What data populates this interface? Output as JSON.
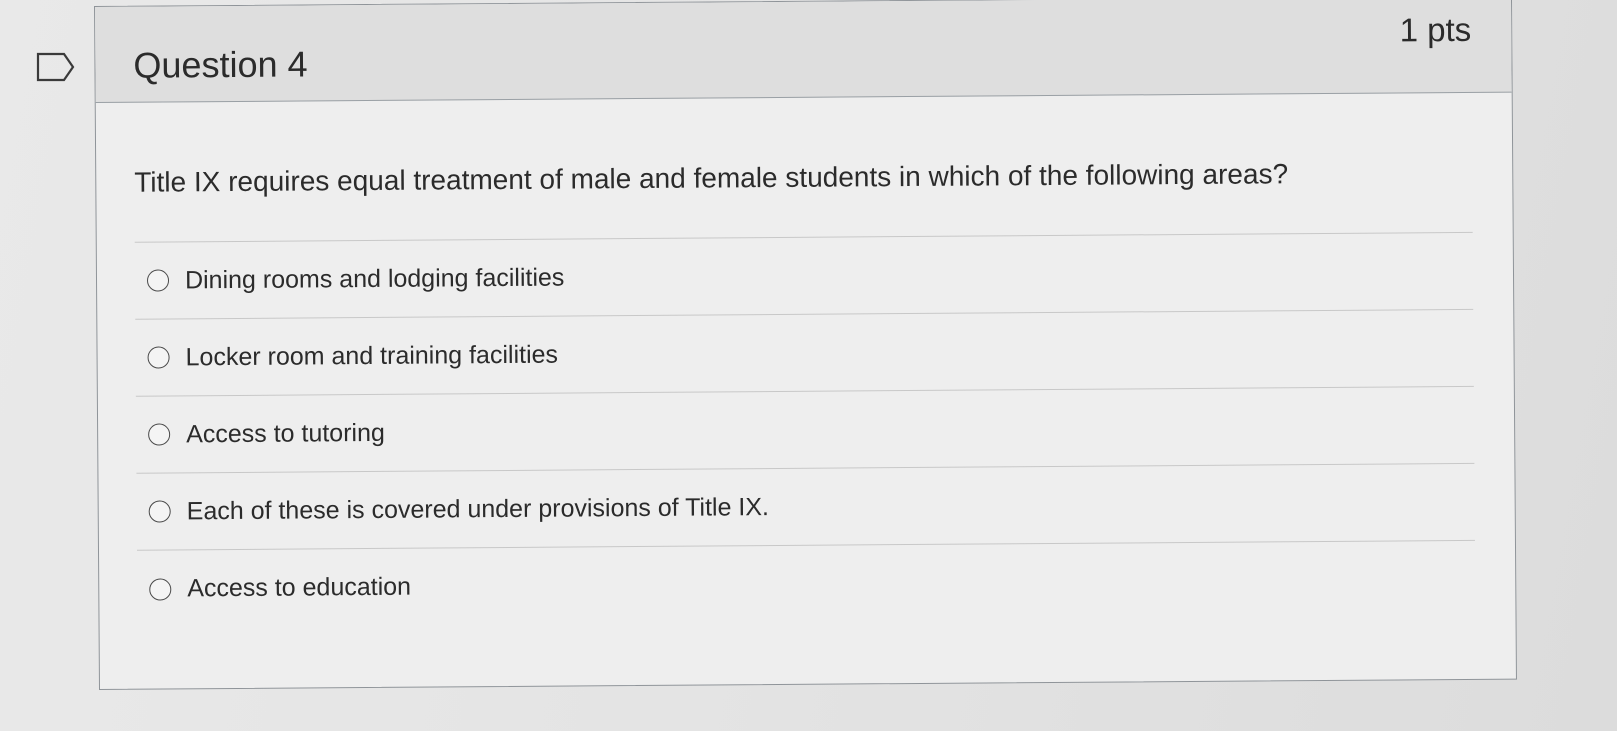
{
  "question": {
    "title": "Question 4",
    "points": "1 pts",
    "text": "Title IX requires equal treatment of male and female students in which of the following areas?",
    "answers": [
      {
        "label": "Dining rooms and lodging facilities",
        "selected": false
      },
      {
        "label": "Locker room and training facilities",
        "selected": false
      },
      {
        "label": "Access to tutoring",
        "selected": false
      },
      {
        "label": "Each of these is covered under provisions of Title IX.",
        "selected": false
      },
      {
        "label": "Access to education",
        "selected": false
      }
    ]
  },
  "icons": {
    "flag": "flag-question-icon"
  }
}
